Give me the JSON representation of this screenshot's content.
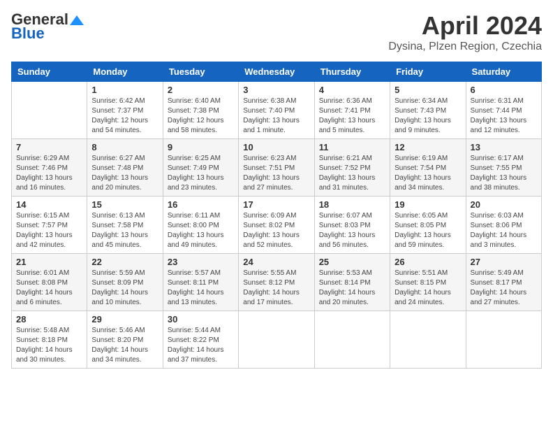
{
  "header": {
    "logo_general": "General",
    "logo_blue": "Blue",
    "month": "April 2024",
    "location": "Dysina, Plzen Region, Czechia"
  },
  "days_of_week": [
    "Sunday",
    "Monday",
    "Tuesday",
    "Wednesday",
    "Thursday",
    "Friday",
    "Saturday"
  ],
  "weeks": [
    [
      {
        "day": "",
        "sunrise": "",
        "sunset": "",
        "daylight": ""
      },
      {
        "day": "1",
        "sunrise": "Sunrise: 6:42 AM",
        "sunset": "Sunset: 7:37 PM",
        "daylight": "Daylight: 12 hours and 54 minutes."
      },
      {
        "day": "2",
        "sunrise": "Sunrise: 6:40 AM",
        "sunset": "Sunset: 7:38 PM",
        "daylight": "Daylight: 12 hours and 58 minutes."
      },
      {
        "day": "3",
        "sunrise": "Sunrise: 6:38 AM",
        "sunset": "Sunset: 7:40 PM",
        "daylight": "Daylight: 13 hours and 1 minute."
      },
      {
        "day": "4",
        "sunrise": "Sunrise: 6:36 AM",
        "sunset": "Sunset: 7:41 PM",
        "daylight": "Daylight: 13 hours and 5 minutes."
      },
      {
        "day": "5",
        "sunrise": "Sunrise: 6:34 AM",
        "sunset": "Sunset: 7:43 PM",
        "daylight": "Daylight: 13 hours and 9 minutes."
      },
      {
        "day": "6",
        "sunrise": "Sunrise: 6:31 AM",
        "sunset": "Sunset: 7:44 PM",
        "daylight": "Daylight: 13 hours and 12 minutes."
      }
    ],
    [
      {
        "day": "7",
        "sunrise": "Sunrise: 6:29 AM",
        "sunset": "Sunset: 7:46 PM",
        "daylight": "Daylight: 13 hours and 16 minutes."
      },
      {
        "day": "8",
        "sunrise": "Sunrise: 6:27 AM",
        "sunset": "Sunset: 7:48 PM",
        "daylight": "Daylight: 13 hours and 20 minutes."
      },
      {
        "day": "9",
        "sunrise": "Sunrise: 6:25 AM",
        "sunset": "Sunset: 7:49 PM",
        "daylight": "Daylight: 13 hours and 23 minutes."
      },
      {
        "day": "10",
        "sunrise": "Sunrise: 6:23 AM",
        "sunset": "Sunset: 7:51 PM",
        "daylight": "Daylight: 13 hours and 27 minutes."
      },
      {
        "day": "11",
        "sunrise": "Sunrise: 6:21 AM",
        "sunset": "Sunset: 7:52 PM",
        "daylight": "Daylight: 13 hours and 31 minutes."
      },
      {
        "day": "12",
        "sunrise": "Sunrise: 6:19 AM",
        "sunset": "Sunset: 7:54 PM",
        "daylight": "Daylight: 13 hours and 34 minutes."
      },
      {
        "day": "13",
        "sunrise": "Sunrise: 6:17 AM",
        "sunset": "Sunset: 7:55 PM",
        "daylight": "Daylight: 13 hours and 38 minutes."
      }
    ],
    [
      {
        "day": "14",
        "sunrise": "Sunrise: 6:15 AM",
        "sunset": "Sunset: 7:57 PM",
        "daylight": "Daylight: 13 hours and 42 minutes."
      },
      {
        "day": "15",
        "sunrise": "Sunrise: 6:13 AM",
        "sunset": "Sunset: 7:58 PM",
        "daylight": "Daylight: 13 hours and 45 minutes."
      },
      {
        "day": "16",
        "sunrise": "Sunrise: 6:11 AM",
        "sunset": "Sunset: 8:00 PM",
        "daylight": "Daylight: 13 hours and 49 minutes."
      },
      {
        "day": "17",
        "sunrise": "Sunrise: 6:09 AM",
        "sunset": "Sunset: 8:02 PM",
        "daylight": "Daylight: 13 hours and 52 minutes."
      },
      {
        "day": "18",
        "sunrise": "Sunrise: 6:07 AM",
        "sunset": "Sunset: 8:03 PM",
        "daylight": "Daylight: 13 hours and 56 minutes."
      },
      {
        "day": "19",
        "sunrise": "Sunrise: 6:05 AM",
        "sunset": "Sunset: 8:05 PM",
        "daylight": "Daylight: 13 hours and 59 minutes."
      },
      {
        "day": "20",
        "sunrise": "Sunrise: 6:03 AM",
        "sunset": "Sunset: 8:06 PM",
        "daylight": "Daylight: 14 hours and 3 minutes."
      }
    ],
    [
      {
        "day": "21",
        "sunrise": "Sunrise: 6:01 AM",
        "sunset": "Sunset: 8:08 PM",
        "daylight": "Daylight: 14 hours and 6 minutes."
      },
      {
        "day": "22",
        "sunrise": "Sunrise: 5:59 AM",
        "sunset": "Sunset: 8:09 PM",
        "daylight": "Daylight: 14 hours and 10 minutes."
      },
      {
        "day": "23",
        "sunrise": "Sunrise: 5:57 AM",
        "sunset": "Sunset: 8:11 PM",
        "daylight": "Daylight: 14 hours and 13 minutes."
      },
      {
        "day": "24",
        "sunrise": "Sunrise: 5:55 AM",
        "sunset": "Sunset: 8:12 PM",
        "daylight": "Daylight: 14 hours and 17 minutes."
      },
      {
        "day": "25",
        "sunrise": "Sunrise: 5:53 AM",
        "sunset": "Sunset: 8:14 PM",
        "daylight": "Daylight: 14 hours and 20 minutes."
      },
      {
        "day": "26",
        "sunrise": "Sunrise: 5:51 AM",
        "sunset": "Sunset: 8:15 PM",
        "daylight": "Daylight: 14 hours and 24 minutes."
      },
      {
        "day": "27",
        "sunrise": "Sunrise: 5:49 AM",
        "sunset": "Sunset: 8:17 PM",
        "daylight": "Daylight: 14 hours and 27 minutes."
      }
    ],
    [
      {
        "day": "28",
        "sunrise": "Sunrise: 5:48 AM",
        "sunset": "Sunset: 8:18 PM",
        "daylight": "Daylight: 14 hours and 30 minutes."
      },
      {
        "day": "29",
        "sunrise": "Sunrise: 5:46 AM",
        "sunset": "Sunset: 8:20 PM",
        "daylight": "Daylight: 14 hours and 34 minutes."
      },
      {
        "day": "30",
        "sunrise": "Sunrise: 5:44 AM",
        "sunset": "Sunset: 8:22 PM",
        "daylight": "Daylight: 14 hours and 37 minutes."
      },
      {
        "day": "",
        "sunrise": "",
        "sunset": "",
        "daylight": ""
      },
      {
        "day": "",
        "sunrise": "",
        "sunset": "",
        "daylight": ""
      },
      {
        "day": "",
        "sunrise": "",
        "sunset": "",
        "daylight": ""
      },
      {
        "day": "",
        "sunrise": "",
        "sunset": "",
        "daylight": ""
      }
    ]
  ]
}
